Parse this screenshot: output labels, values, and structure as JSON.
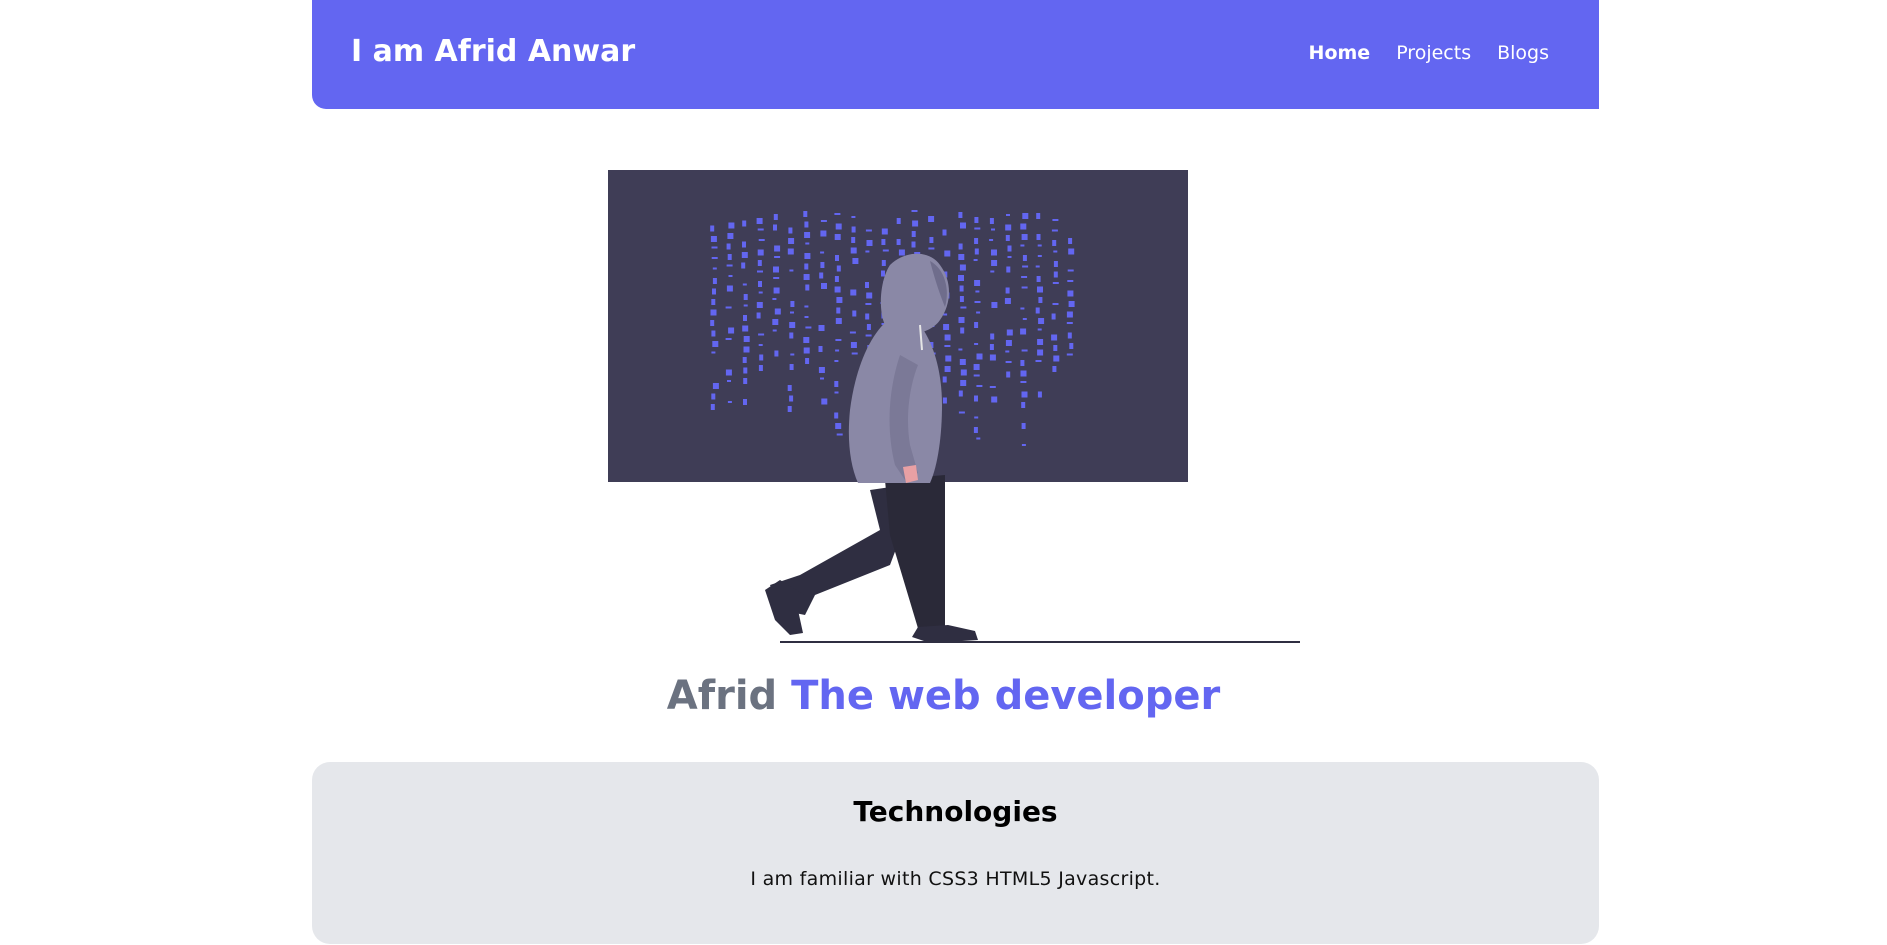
{
  "header": {
    "brand": "I am Afrid Anwar",
    "nav": [
      "Home",
      "Projects",
      "Blogs"
    ],
    "active_nav": "Home",
    "background_color": "#6366f1"
  },
  "hero": {
    "illustration": "hooded-person-walking-past-code-screen",
    "screen_color": "#3f3d56",
    "code_color": "#6366f1",
    "figure_hoodie_color": "#8a88a6",
    "figure_pants_color": "#2f2e41"
  },
  "tagline": {
    "name": "Afrid",
    "role": "The web developer",
    "name_color": "#6b7280",
    "role_color": "#6366f1"
  },
  "technologies": {
    "title": "Technologies",
    "text": "I am familiar with CSS3 HTML5 Javascript.",
    "card_color": "#e5e7eb"
  }
}
